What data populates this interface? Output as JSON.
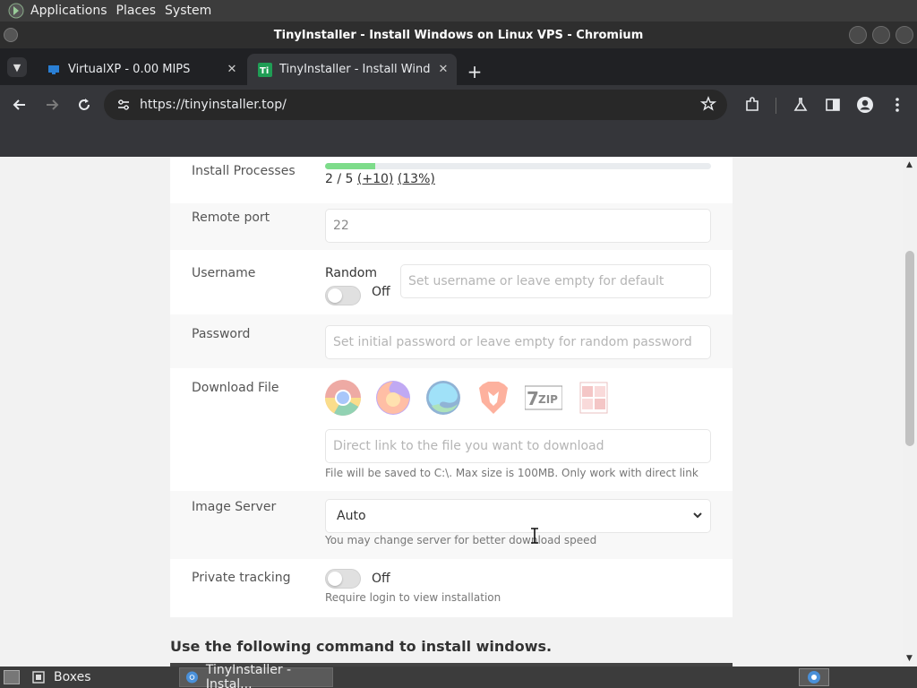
{
  "top_panel": {
    "menus": [
      "Applications",
      "Places",
      "System"
    ]
  },
  "window": {
    "title": "TinyInstaller - Install Windows on Linux VPS - Chromium"
  },
  "tabs": [
    {
      "title": "VirtualXP - 0.00 MIPS",
      "favicon": "monitor-icon",
      "active": false
    },
    {
      "title": "TinyInstaller - Install Windo",
      "favicon": "tinyinstaller-logo-icon",
      "active": true
    }
  ],
  "toolbar": {
    "url": "https://tinyinstaller.top/"
  },
  "form": {
    "install_processes": {
      "label": "Install Processes",
      "progress": 0.13,
      "count_text": "2 / 5",
      "plus_text": "(+10)",
      "percent_text": "(13%)"
    },
    "remote_port": {
      "label": "Remote port",
      "value": "22"
    },
    "username": {
      "label": "Username",
      "random_label": "Random",
      "toggle_state": "Off",
      "placeholder": "Set username or leave empty for default"
    },
    "password": {
      "label": "Password",
      "placeholder": "Set initial password or leave empty for random password"
    },
    "download_file": {
      "label": "Download File",
      "icons": [
        "chrome-icon",
        "firefox-icon",
        "edge-icon",
        "brave-icon",
        "7zip-icon",
        "winrar-icon"
      ],
      "placeholder": "Direct link to the file you want to download",
      "helper": "File will be saved to C:\\. Max size is 100MB. Only work with direct link"
    },
    "image_server": {
      "label": "Image Server",
      "selected": "Auto",
      "helper": "You may change server for better download speed"
    },
    "private_tracking": {
      "label": "Private tracking",
      "toggle_state": "Off",
      "helper": "Require login to view installation"
    }
  },
  "command_heading": "Use the following command to install windows.",
  "taskbar": {
    "items": [
      "Boxes",
      "TinyInstaller - Instal..."
    ]
  }
}
